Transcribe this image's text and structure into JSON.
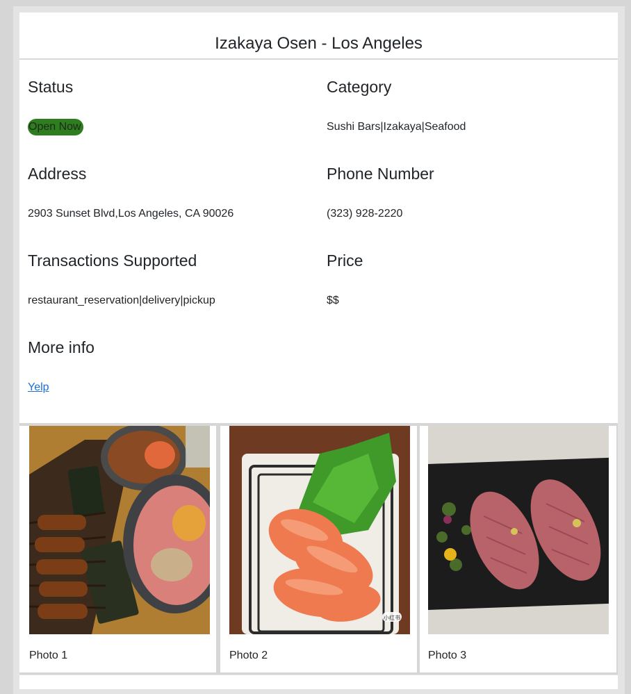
{
  "page": {
    "title": "Izakaya Osen - Los Angeles"
  },
  "fields": {
    "status": {
      "label": "Status",
      "value": "Open Now",
      "color": "#2e7d1f"
    },
    "category": {
      "label": "Category",
      "value": "Sushi Bars|Izakaya|Seafood"
    },
    "address": {
      "label": "Address",
      "value": "2903 Sunset Blvd,Los Angeles, CA 90026"
    },
    "phone": {
      "label": "Phone Number",
      "value": "(323) 928-2220"
    },
    "transactions": {
      "label": "Transactions Supported",
      "value": "restaurant_reservation|delivery|pickup"
    },
    "price": {
      "label": "Price",
      "value": "$$"
    },
    "more_info": {
      "label": "More info",
      "link_text": "Yelp"
    }
  },
  "photos": [
    {
      "caption": "Photo 1",
      "icon": "grilled-skewers-donburi-photo"
    },
    {
      "caption": "Photo 2",
      "icon": "salmon-sashimi-photo",
      "watermark": "小红书"
    },
    {
      "caption": "Photo 3",
      "icon": "tuna-nigiri-photo"
    }
  ],
  "colors": {
    "link": "#1a6fd6",
    "background": "#d6d6d6",
    "card": "#ffffff"
  }
}
